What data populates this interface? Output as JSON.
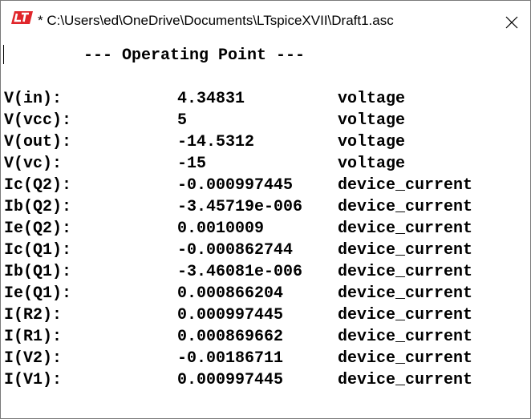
{
  "window": {
    "title": "* C:\\Users\\ed\\OneDrive\\Documents\\LTspiceXVII\\Draft1.asc",
    "app_icon": "ltspice-logo-icon",
    "close_icon": "close-icon"
  },
  "content": {
    "heading": "--- Operating Point ---",
    "rows": [
      {
        "name": "V(in):",
        "value": "4.34831",
        "type": "voltage"
      },
      {
        "name": "V(vcc):",
        "value": "5",
        "type": "voltage"
      },
      {
        "name": "V(out):",
        "value": "-14.5312",
        "type": "voltage"
      },
      {
        "name": "V(vc):",
        "value": "-15",
        "type": "voltage"
      },
      {
        "name": "Ic(Q2):",
        "value": "-0.000997445",
        "type": "device_current"
      },
      {
        "name": "Ib(Q2):",
        "value": "-3.45719e-006",
        "type": "device_current"
      },
      {
        "name": "Ie(Q2):",
        "value": "0.0010009",
        "type": "device_current"
      },
      {
        "name": "Ic(Q1):",
        "value": "-0.000862744",
        "type": "device_current"
      },
      {
        "name": "Ib(Q1):",
        "value": "-3.46081e-006",
        "type": "device_current"
      },
      {
        "name": "Ie(Q1):",
        "value": "0.000866204",
        "type": "device_current"
      },
      {
        "name": "I(R2):",
        "value": "0.000997445",
        "type": "device_current"
      },
      {
        "name": "I(R1):",
        "value": "0.000869662",
        "type": "device_current"
      },
      {
        "name": "I(V2):",
        "value": "-0.00186711",
        "type": "device_current"
      },
      {
        "name": "I(V1):",
        "value": "0.000997445",
        "type": "device_current"
      }
    ]
  },
  "colors": {
    "logo_red": "#e0262b",
    "text": "#000000",
    "background": "#ffffff",
    "border": "#7a7a7a"
  }
}
